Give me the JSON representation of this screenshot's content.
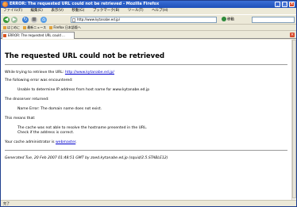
{
  "window": {
    "title": "ERROR: The requested URL could not be retrieved - Mozilla Firefox"
  },
  "menubar": {
    "items": [
      "ファイル(F)",
      "編集(E)",
      "表示(V)",
      "移動(G)",
      "ブックマーク(B)",
      "ツール(T)",
      "ヘルプ(H)"
    ]
  },
  "navbar": {
    "url": "http://www.kytanabe.ed.jp/",
    "go_label": "移動"
  },
  "bookmarks": {
    "items": [
      "はじめに",
      "最新ニュース",
      "Firefox 日本語版ヘ"
    ]
  },
  "tab": {
    "label": "ERROR: The requested URL could ..."
  },
  "page": {
    "heading": "The requested URL could not be retrieved",
    "retrieve_prefix": "While trying to retrieve the URL: ",
    "retrieve_url": "http://www.kytanabe.ed.jp/",
    "error_encountered": "The following error was encountered:",
    "error_detail": "Unable to determine IP address from host name for www.kytanabe.ed.jp",
    "dns_returned": "The dnsserver returned:",
    "dns_detail": "Name Error: The domain name does not exist.",
    "means_that": "This means that:",
    "explain_line1": "The cache was not able to resolve the hostname presented in the URL.",
    "explain_line2": "Check if the address is correct.",
    "admin_prefix": "Your cache administrator is ",
    "admin_link": "webmaster",
    "admin_suffix": ".",
    "generated": "Generated Tue, 20 Feb 2007 01:48:51 GMT by zoed.kytanabe.ed.jp (squid/2.5.STABLE12)"
  },
  "status": {
    "text": "完了"
  }
}
